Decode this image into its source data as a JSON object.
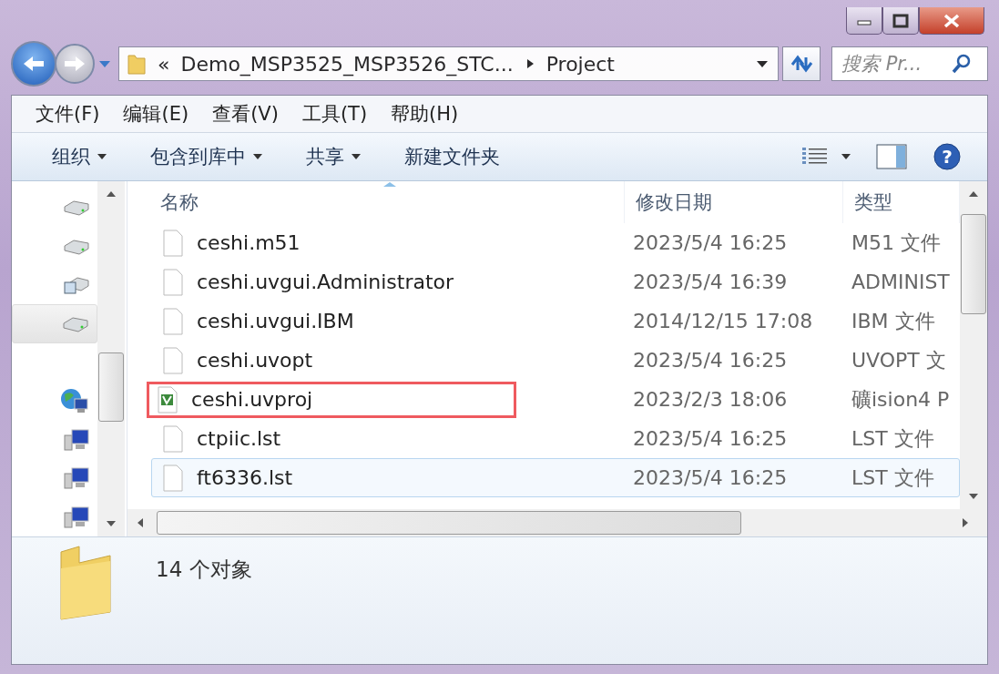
{
  "address_bar": {
    "overflow_glyph": "«",
    "path": [
      "Demo_MSP3525_MSP3526_STC...",
      "Project"
    ]
  },
  "search": {
    "placeholder": "搜索 Pr..."
  },
  "menu_bar": [
    "文件(F)",
    "编辑(E)",
    "查看(V)",
    "工具(T)",
    "帮助(H)"
  ],
  "toolbar": [
    {
      "label": "组织",
      "dropdown": true
    },
    {
      "label": "包含到库中",
      "dropdown": true
    },
    {
      "label": "共享",
      "dropdown": true
    },
    {
      "label": "新建文件夹",
      "dropdown": false
    }
  ],
  "nav_pane": {
    "items": [
      {
        "kind": "drive",
        "selected": false
      },
      {
        "kind": "drive",
        "selected": false
      },
      {
        "kind": "image-drive",
        "selected": false
      },
      {
        "kind": "drive",
        "selected": true
      },
      {
        "kind": "gap",
        "selected": false
      },
      {
        "kind": "network",
        "selected": false
      },
      {
        "kind": "computer",
        "selected": false
      },
      {
        "kind": "computer",
        "selected": false
      },
      {
        "kind": "computer",
        "selected": false
      }
    ]
  },
  "file_list": {
    "columns": [
      {
        "label": "名称",
        "sorted": true
      },
      {
        "label": "修改日期",
        "sorted": false
      },
      {
        "label": "类型",
        "sorted": false
      }
    ],
    "rows": [
      {
        "name": "ceshi.m51",
        "date": "2023/5/4 16:25",
        "type": "M51 文件",
        "kind": "plain",
        "highlighted": false,
        "hovered": false
      },
      {
        "name": "ceshi.uvgui.Administrator",
        "date": "2023/5/4 16:39",
        "type": "ADMINIST",
        "kind": "plain",
        "highlighted": false,
        "hovered": false
      },
      {
        "name": "ceshi.uvgui.IBM",
        "date": "2014/12/15 17:08",
        "type": "IBM 文件",
        "kind": "plain",
        "highlighted": false,
        "hovered": false
      },
      {
        "name": "ceshi.uvopt",
        "date": "2023/5/4 16:25",
        "type": "UVOPT 文",
        "kind": "plain",
        "highlighted": false,
        "hovered": false
      },
      {
        "name": "ceshi.uvproj",
        "date": "2023/2/3 18:06",
        "type": "礦ision4 P",
        "kind": "project",
        "highlighted": true,
        "hovered": false
      },
      {
        "name": "ctpiic.lst",
        "date": "2023/5/4 16:25",
        "type": "LST 文件",
        "kind": "plain",
        "highlighted": false,
        "hovered": false
      },
      {
        "name": "ft6336.lst",
        "date": "2023/5/4 16:25",
        "type": "LST 文件",
        "kind": "plain",
        "highlighted": false,
        "hovered": true
      }
    ]
  },
  "help_button": {
    "glyph": "?"
  },
  "details_pane": {
    "count": "14 个对象"
  }
}
